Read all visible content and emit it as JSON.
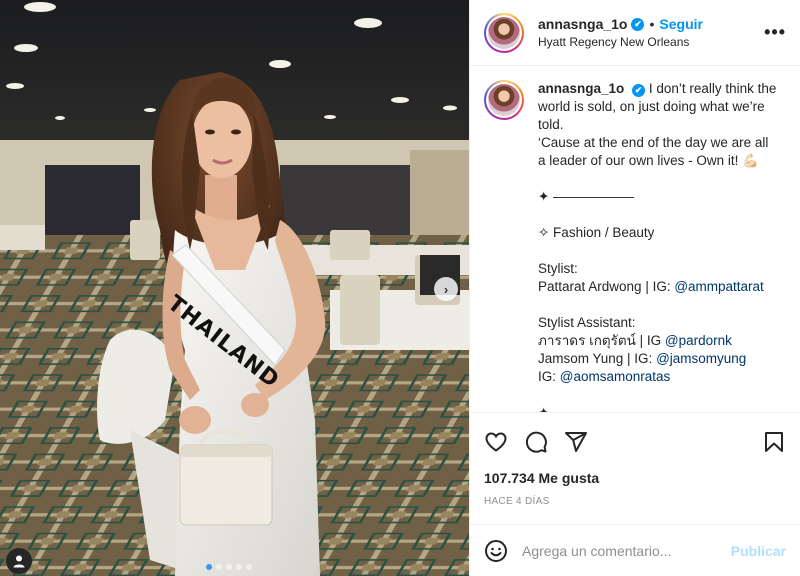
{
  "post": {
    "username": "annasnga_1o",
    "verified_mark": "✔",
    "follow_separator": "•",
    "follow_label": "Seguir",
    "location": "Hyatt Regency New Orleans",
    "more_icon": "more-horizontal-icon",
    "sash_text": "THAILAND",
    "carousel": {
      "total": 5,
      "current": 1
    },
    "next_icon": "chevron-right-icon"
  },
  "caption": {
    "lines": [
      "I don’t really think the world is sold, on just doing what we’re told.",
      "‘Cause at the end of the day we are all a leader of our own lives - Own it! 💪🏻",
      "",
      "✦ ——————",
      "",
      "✧ Fashion / Beauty",
      "",
      "Stylist:",
      "Pattarat Ardwong | IG: ",
      "",
      "Stylist Assistant:",
      "ภาราดร เกตุรัตน์ | IG ",
      "Jamsom Yung | IG: ",
      "IG: ",
      "",
      "✦ ——————"
    ],
    "mentions": {
      "stylist": "@ammpattarat",
      "assistant1": "@pardornk",
      "assistant2": "@jamsomyung",
      "assistant3": "@aomsamonratas"
    }
  },
  "actions": {
    "like_icon": "heart-icon",
    "comment_icon": "comment-icon",
    "share_icon": "send-icon",
    "save_icon": "bookmark-icon"
  },
  "likes": "107.734 Me gusta",
  "timestamp": "HACE 4 DÍAS",
  "comment": {
    "placeholder": "Agrega un comentario...",
    "value": "",
    "publish_label": "Publicar",
    "emoji_icon": "smiley-icon"
  },
  "colors": {
    "link_blue": "#0095f6",
    "mention_blue": "#00376b",
    "publish_disabled": "#b2dffc",
    "muted": "#8e8e8e"
  }
}
